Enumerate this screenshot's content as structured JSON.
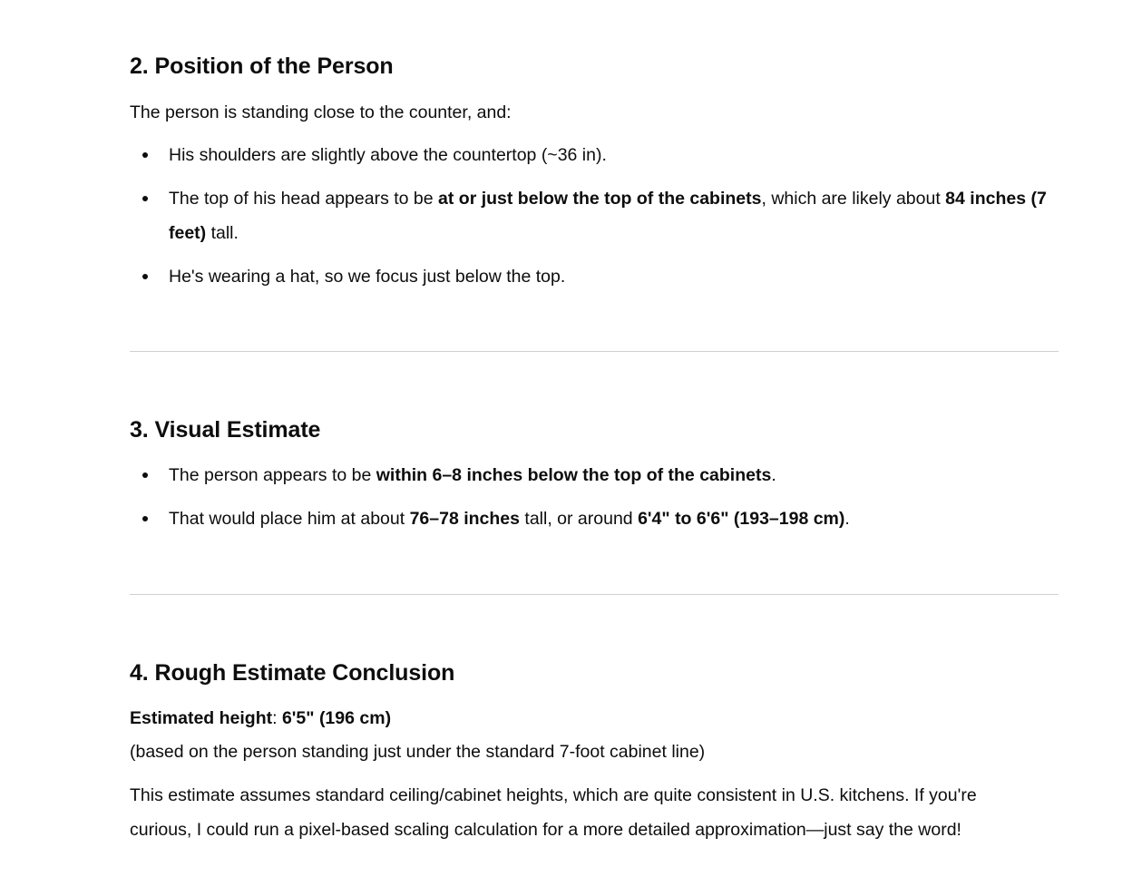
{
  "section2": {
    "title": "2. Position of the Person",
    "intro": "The person is standing close to the counter, and:",
    "bullet1": "His shoulders are slightly above the countertop (~36 in).",
    "bullet2_a": "The top of his head appears to be ",
    "bullet2_b": "at or just below the top of the cabinets",
    "bullet2_c": ", which are likely about ",
    "bullet2_d": "84 inches (7 feet)",
    "bullet2_e": " tall.",
    "bullet3": "He's wearing a hat, so we focus just below the top."
  },
  "section3": {
    "title": "3. Visual Estimate",
    "bullet1_a": "The person appears to be ",
    "bullet1_b": "within 6–8 inches below the top of the cabinets",
    "bullet1_c": ".",
    "bullet2_a": "That would place him at about ",
    "bullet2_b": "76–78 inches",
    "bullet2_c": " tall, or around ",
    "bullet2_d": "6'4\" to 6'6\" (193–198 cm)",
    "bullet2_e": "."
  },
  "section4": {
    "title": "4. Rough Estimate Conclusion",
    "est_label": "Estimated height",
    "est_sep": ": ",
    "est_value": "6'5\" (196 cm)",
    "basis": "(based on the person standing just under the standard 7-foot cabinet line)",
    "note": "This estimate assumes standard ceiling/cabinet heights, which are quite consistent in U.S. kitchens. If you're curious, I could run a pixel-based scaling calculation for a more detailed approximation—just say the word!"
  }
}
